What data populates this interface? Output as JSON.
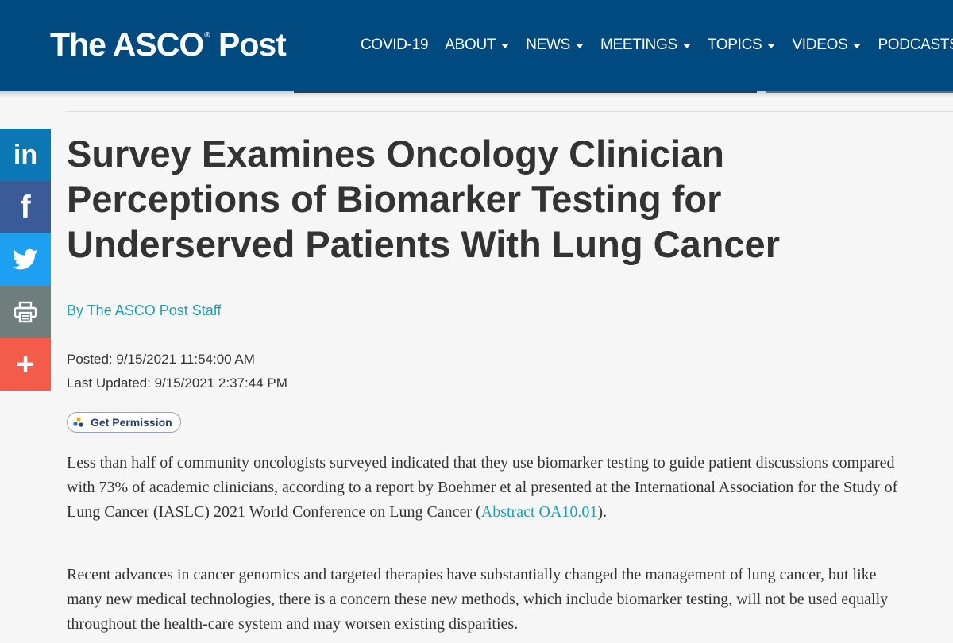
{
  "header": {
    "logo_text": "The ASCO Post",
    "nav": [
      {
        "label": "COVID-19",
        "dropdown": false
      },
      {
        "label": "ABOUT",
        "dropdown": true
      },
      {
        "label": "NEWS",
        "dropdown": true
      },
      {
        "label": "MEETINGS",
        "dropdown": true
      },
      {
        "label": "TOPICS",
        "dropdown": true
      },
      {
        "label": "VIDEOS",
        "dropdown": true
      },
      {
        "label": "PODCASTS",
        "dropdown": false
      }
    ],
    "background": "#004a80"
  },
  "share": {
    "linkedin": "in",
    "facebook": "f",
    "twitter_icon": "twitter-bird",
    "print_icon": "printer",
    "more": "+",
    "colors": {
      "linkedin": "#0b78b5",
      "facebook": "#3b5b98",
      "twitter": "#1da0f1",
      "print": "#6f7d7d",
      "more": "#f35c4a"
    }
  },
  "article": {
    "title": "Survey Examines Oncology Clinician Perceptions of Biomarker Testing for Underserved Patients With Lung Cancer",
    "byline": "By The ASCO Post Staff",
    "posted": "Posted: 9/15/2021 11:54:00 AM",
    "updated": "Last Updated: 9/15/2021 2:37:44 PM",
    "permission_label": "Get Permission",
    "p1_before": "Less than half of community oncologists surveyed indicated that they use biomarker testing to guide patient discussions compared with 73% of academic clinicians, according to a report by Boehmer et al presented at the International Association for the Study of Lung Cancer (IASLC) 2021 World Conference on Lung Cancer (",
    "p1_link": "Abstract OA10.01",
    "p1_after": ").",
    "p2": "Recent advances in cancer genomics and targeted therapies have substantially changed the management of lung cancer, but like many new medical technologies, there is a concern these new methods, which include biomarker testing, will not be used equally throughout the health-care system and may worsen existing disparities."
  },
  "colors": {
    "accent": "#1ea0b4",
    "text": "#333333"
  }
}
